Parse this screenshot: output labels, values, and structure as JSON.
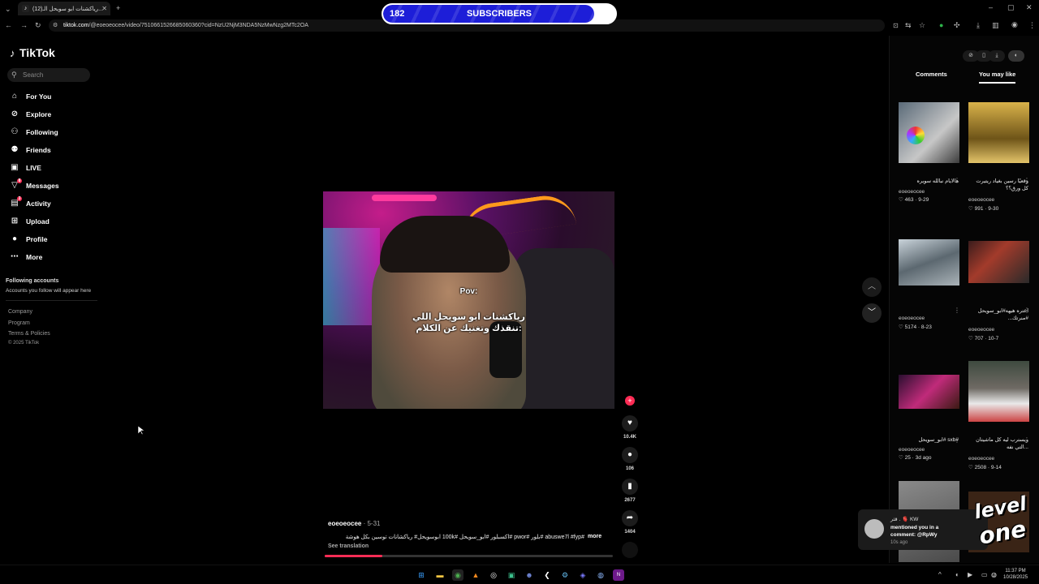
{
  "browser": {
    "tab_title": "(12)رياكشنات ابو سويحل الـ...",
    "url_host": "tiktok.com",
    "url_path": "/@eoeoeocee/video/7510661526685060360?cid=NzU2NjM3NDA5NzMwNzg2MTc2OA"
  },
  "overlay": {
    "current": "182",
    "label": "SUBSCRIBERS",
    "goal": "200",
    "progress_fraction": 0.91
  },
  "sidebar": {
    "logo": "TikTok",
    "search_placeholder": "Search",
    "items": [
      {
        "label": "For You",
        "icon": "home-icon"
      },
      {
        "label": "Explore",
        "icon": "compass-icon"
      },
      {
        "label": "Following",
        "icon": "following-icon"
      },
      {
        "label": "Friends",
        "icon": "friends-icon"
      },
      {
        "label": "LIVE",
        "icon": "live-icon"
      },
      {
        "label": "Messages",
        "icon": "messages-icon",
        "badge": "8"
      },
      {
        "label": "Activity",
        "icon": "activity-icon",
        "badge": "3"
      },
      {
        "label": "Upload",
        "icon": "upload-icon"
      },
      {
        "label": "Profile",
        "icon": "avatar-icon"
      },
      {
        "label": "More",
        "icon": "more-icon"
      }
    ],
    "following_header": "Following accounts",
    "following_note": "Accounts you follow will appear here",
    "footer": [
      "Company",
      "Program",
      "Terms & Policies",
      "© 2025 TikTok"
    ]
  },
  "video": {
    "caption_pov": "Pov:",
    "caption_line1": "رياكشنات ابو سويحل اللي",
    "caption_line2": "تنقذك وتغنيك عن الكلام:",
    "playback_progress": 0.2
  },
  "actions": {
    "likes": "10.4K",
    "comments": "106",
    "saves": "2677",
    "shares": "1404"
  },
  "post": {
    "author": "eoeoeocee",
    "date": "· 5-31",
    "description": "#abuswe7l #fyp #بلور #pwor #اكسبلور #ابو_سويحل #100k ابوسويحل# رياكشانات توسين بكل هوشة",
    "more": "more",
    "see_translation": "See translation"
  },
  "right_panel": {
    "tabs": [
      "Comments",
      "You may like"
    ],
    "cards": [
      {
        "title": "هالايام نبالله سويره",
        "user": "eoeoeocee",
        "stats": "463 · 9-29"
      },
      {
        "title": "وقعيًا رسين بغياد ريتيرت كل ورق؟؟",
        "user": "eoeoeocee",
        "stats": "991 · 9-30"
      },
      {
        "title": "",
        "user": "eoeoeocee",
        "stats": "5174 · 8-23"
      },
      {
        "title": "اعتره هيهه#ابو_سويحل #منرتك...",
        "user": "eoeoeocee",
        "stats": "707 · 10-7"
      },
      {
        "title": "#sxb #ابو_سويحل",
        "user": "eoeoeocee",
        "stats": "25 · 3d ago"
      },
      {
        "title": "ويسترب ليه كل ماشيتان ...التي نفه",
        "user": "eoeoeocee",
        "stats": "2508 · 9-14"
      }
    ]
  },
  "notification": {
    "line1": "قثر . 🫀 KW",
    "line2": "mentioned you in a comment: @RpWy",
    "time": "10s ago"
  },
  "brand_logo": {
    "line1": "level",
    "line2": "one"
  },
  "taskbar": {
    "time": "11:37 PM",
    "date": "10/28/2025"
  },
  "colors": {
    "accent": "#fe2c55",
    "overlay_fill": "#1d1ed8"
  }
}
